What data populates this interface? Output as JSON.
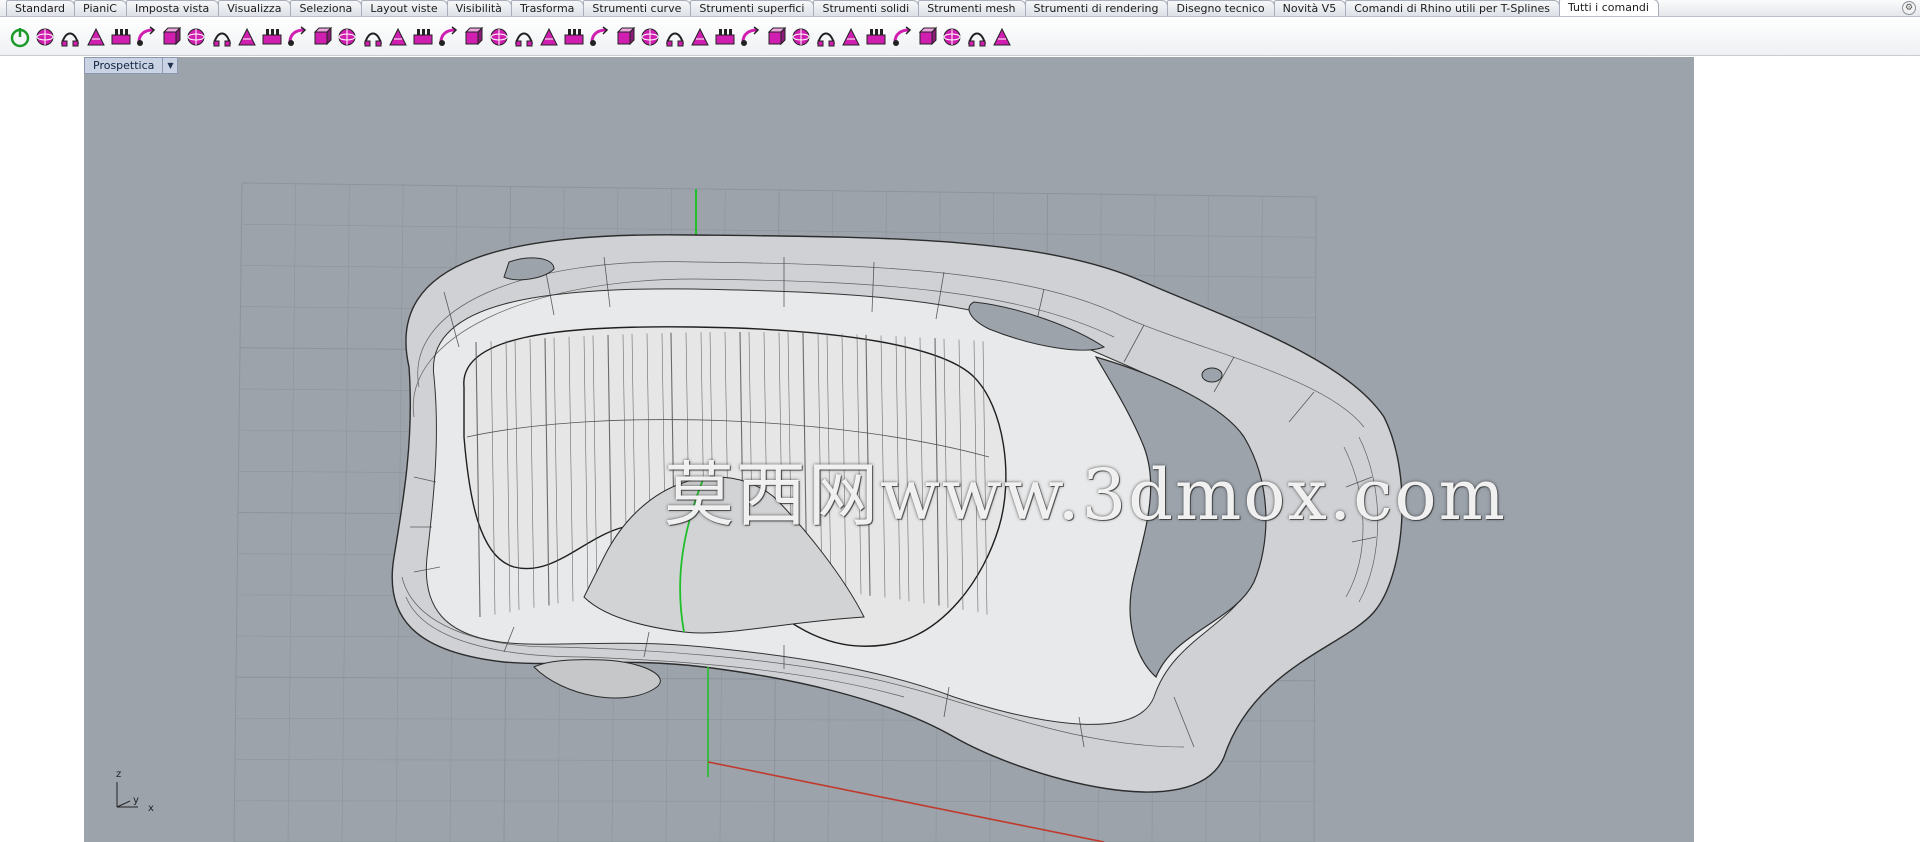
{
  "tabs": [
    {
      "label": "Standard"
    },
    {
      "label": "PianiC"
    },
    {
      "label": "Imposta vista"
    },
    {
      "label": "Visualizza"
    },
    {
      "label": "Seleziona"
    },
    {
      "label": "Layout viste"
    },
    {
      "label": "Visibilità"
    },
    {
      "label": "Trasforma"
    },
    {
      "label": "Strumenti curve"
    },
    {
      "label": "Strumenti superfici"
    },
    {
      "label": "Strumenti solidi"
    },
    {
      "label": "Strumenti mesh"
    },
    {
      "label": "Strumenti di rendering"
    },
    {
      "label": "Disegno tecnico"
    },
    {
      "label": "Novità V5"
    },
    {
      "label": "Comandi di Rhino utili per T-Splines"
    },
    {
      "label": "Tutti i comandi",
      "active": true
    }
  ],
  "toolbar": {
    "icons": [
      "power-icon",
      "box-icon",
      "sphere-icon",
      "curve-tool-icon",
      "array-icon",
      "solid-union-icon",
      "flow-arrow-icon",
      "surface-loft-icon",
      "rotate-icon",
      "gumball-icon",
      "arch-icon",
      "extrude-icon",
      "offset-icon",
      "cube-cut-icon",
      "box-magenta-icon",
      "sweep-icon",
      "grid-array-icon",
      "checkbox-icon",
      "grid-icon",
      "mesh-grid-icon",
      "curve-network-icon",
      "pipe-icon",
      "analyze-icon",
      "cylinder-icon",
      "vertex-grid-icon",
      "dot-grid-icon",
      "blend-icon",
      "hand-icon",
      "tangent-icon",
      "branch-icon",
      "diamond-icon",
      "compass-icon",
      "star-icon",
      "polygon-icon",
      "panel-icon",
      "fold-icon",
      "layer-icon",
      "scissors-icon",
      "capsule-icon",
      "gear-icon"
    ]
  },
  "viewport": {
    "title": "Prospettica",
    "axes": {
      "z": "z",
      "y": "y",
      "x": "x"
    }
  },
  "watermark": "莫西网www.3dmox.com",
  "colors": {
    "viewport_bg": "#9ca3ab",
    "accent_magenta": "#d01fb0",
    "grid_line": "#8d949c",
    "axis_green": "#1fbf2b",
    "axis_red": "#c0392b"
  }
}
